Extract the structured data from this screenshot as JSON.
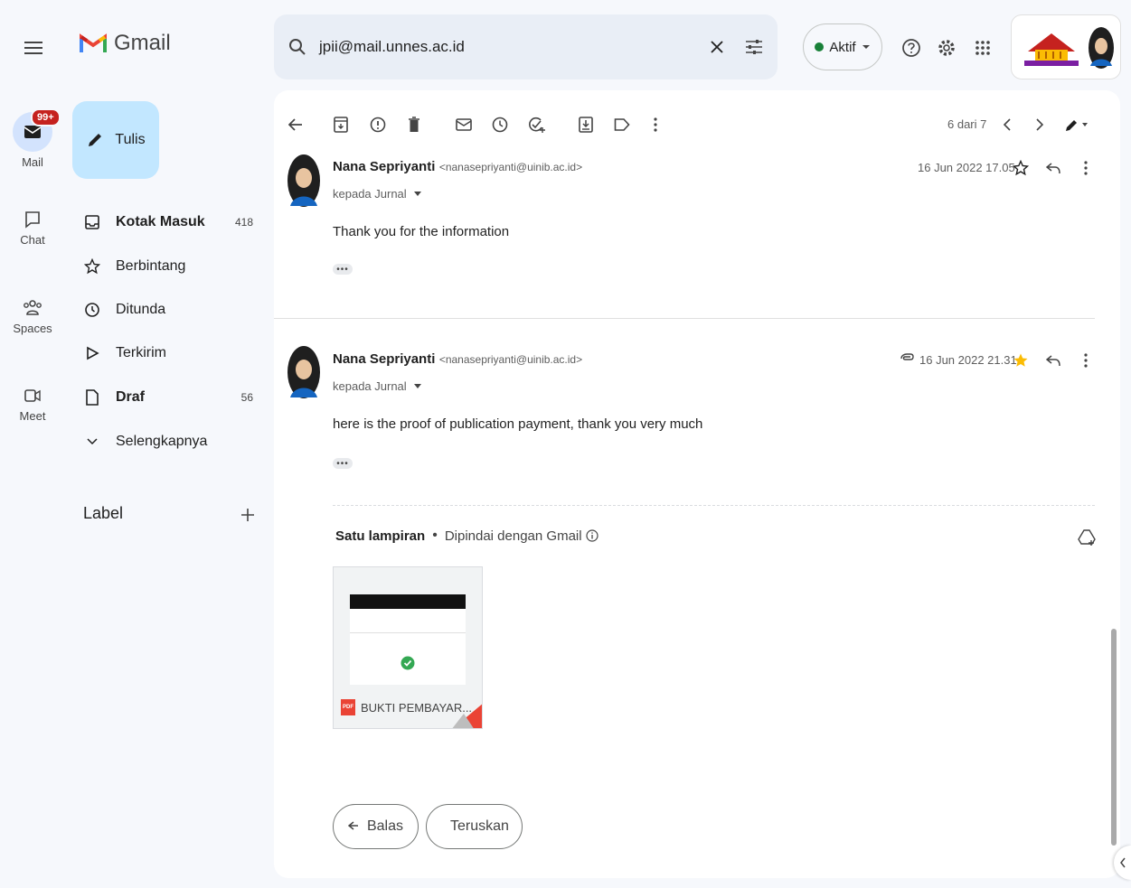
{
  "app": {
    "name": "Gmail"
  },
  "search": {
    "value": "jpii@mail.unnes.ac.id"
  },
  "header": {
    "status_label": "Aktif"
  },
  "compose": {
    "label": "Tulis"
  },
  "rail": {
    "mail": {
      "label": "Mail",
      "badge": "99+"
    },
    "chat": {
      "label": "Chat"
    },
    "spaces": {
      "label": "Spaces"
    },
    "meet": {
      "label": "Meet"
    }
  },
  "nav": {
    "inbox": {
      "label": "Kotak Masuk",
      "count": "418"
    },
    "starred": {
      "label": "Berbintang"
    },
    "snoozed": {
      "label": "Ditunda"
    },
    "sent": {
      "label": "Terkirim"
    },
    "drafts": {
      "label": "Draf",
      "count": "56"
    },
    "more": {
      "label": "Selengkapnya"
    },
    "labels_heading": "Label"
  },
  "toolbar": {
    "pagination": "6 dari 7"
  },
  "messages": [
    {
      "sender": "Nana Sepriyanti",
      "email": "<nanasepriyanti@uinib.ac.id>",
      "to": "kepada Jurnal",
      "date": "16 Jun 2022 17.05",
      "body": "Thank you for the information"
    },
    {
      "sender": "Nana Sepriyanti",
      "email": "<nanasepriyanti@uinib.ac.id>",
      "to": "kepada Jurnal",
      "date": "16 Jun 2022 21.31",
      "body": "here is the proof of publication payment, thank you very much"
    }
  ],
  "attachments": {
    "title": "Satu lampiran",
    "scanned": "Dipindai dengan Gmail",
    "file_name": "BUKTI PEMBAYAR...",
    "file_type": "PDF"
  },
  "actions": {
    "reply": "Balas",
    "forward": "Teruskan"
  },
  "colors": {
    "accent_blue": "#c2e7ff",
    "star": "#fbbc04",
    "active_green": "#188038",
    "pdf_red": "#ea4335"
  }
}
